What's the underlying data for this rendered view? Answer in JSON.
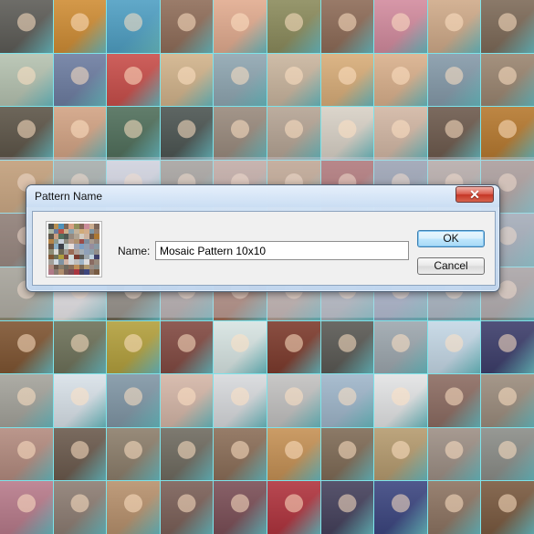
{
  "dialog": {
    "title": "Pattern Name",
    "close_label": "✕",
    "name_label": "Name:",
    "name_value": "Mosaic Pattern 10x10",
    "ok_label": "OK",
    "cancel_label": "Cancel"
  },
  "mosaic": {
    "rows": 10,
    "cols": 10,
    "tile_colors": [
      "#5d5c57",
      "#cf8d35",
      "#4f9fc3",
      "#8f6d59",
      "#e1ab8f",
      "#8b8b5c",
      "#8d6b57",
      "#d28b9e",
      "#cfaa89",
      "#7d6a58",
      "#b5c2b0",
      "#6d7da1",
      "#c84e4a",
      "#d1b38b",
      "#8fa6b1",
      "#c9b59e",
      "#d8ad79",
      "#d9b08c",
      "#859aa9",
      "#9a8570",
      "#5d5548",
      "#d2a384",
      "#506f5b",
      "#4c5552",
      "#998a7d",
      "#b5a494",
      "#d8d1c6",
      "#d2b7a4",
      "#6d5a4d",
      "#b6792f",
      "#b98645",
      "#8f9d92",
      "#cfd6e0",
      "#8f8d80",
      "#b99b8b",
      "#b69470",
      "#9e4d49",
      "#7f8ea0",
      "#a89b90",
      "#96857b",
      "#6b5440",
      "#8fb2c8",
      "#3b3f47",
      "#c7d5d2",
      "#f0e6e2",
      "#a1a8b8",
      "#80a2c7",
      "#96a1b2",
      "#9a8f9f",
      "#8c9ca7",
      "#8e8d76",
      "#e2e2de",
      "#6d6855",
      "#a39b95",
      "#9e6d56",
      "#b3a298",
      "#a8b2b9",
      "#93a4bc",
      "#8ea2ad",
      "#95908b",
      "#7f5532",
      "#6e725a",
      "#b3a03d",
      "#824a42",
      "#d7e4e2",
      "#7d3b2d",
      "#5a5954",
      "#9da7ae",
      "#c4d7e5",
      "#3d3e6b",
      "#a4a39b",
      "#d8e1e8",
      "#8096a5",
      "#d4b6a7",
      "#d7d9dc",
      "#c2c1c0",
      "#9fb6ca",
      "#e2e3e4",
      "#8c6c62",
      "#9b8c7d",
      "#b38b7f",
      "#6b5a4d",
      "#8c7e6b",
      "#6f6b60",
      "#8b6e58",
      "#c59155",
      "#7f6b56",
      "#b59b6f",
      "#9d8f85",
      "#8b8d88",
      "#b87b8b",
      "#8d7d73",
      "#b7916d",
      "#7b6058",
      "#7b4f57",
      "#b0343e",
      "#45415c",
      "#3c4680",
      "#8d7462",
      "#7a5a40"
    ]
  },
  "preview": {
    "cell_colors": [
      "#4f514f",
      "#b88f52",
      "#4f93bc",
      "#7f6757",
      "#d8a184",
      "#92905c",
      "#856657",
      "#cb8d9a",
      "#ccad8f",
      "#7d6759",
      "#aeb7a6",
      "#6b7b9b",
      "#bb5347",
      "#cdb08d",
      "#8aa3ae",
      "#c3b29b",
      "#d0aa79",
      "#d2ad8c",
      "#7f97a5",
      "#987f6c",
      "#5e5649",
      "#cb9f82",
      "#53715f",
      "#4f5853",
      "#978a7e",
      "#b0a392",
      "#d3ccc1",
      "#ccb29f",
      "#6d5a4c",
      "#ad7833",
      "#b48447",
      "#8d9a90",
      "#c9d0da",
      "#8b897d",
      "#b89a89",
      "#af916f",
      "#9b4d48",
      "#7e8d9d",
      "#a89b8f",
      "#93857b",
      "#6b5541",
      "#8aaec4",
      "#3d4049",
      "#c0cecc",
      "#e8dfdc",
      "#9da3b4",
      "#7c9ec2",
      "#939fb0",
      "#968d9d",
      "#8999a4",
      "#8c8c75",
      "#dadad6",
      "#6c6755",
      "#a09893",
      "#9b6c56",
      "#ae9f96",
      "#a5afb6",
      "#8fa0b8",
      "#8b9fab",
      "#928d89",
      "#7d5533",
      "#6d715a",
      "#ad9d40",
      "#804b43",
      "#d0dddb",
      "#7b3c2f",
      "#5b5a55",
      "#9ba5ac",
      "#c0d2df",
      "#40416b",
      "#a29f99",
      "#d2dbe2",
      "#7f93a2",
      "#d0b4a6",
      "#d2d5d8",
      "#bebdbc",
      "#9db3c5",
      "#dcdcdd",
      "#8a6c63",
      "#97897b",
      "#ae887c",
      "#6a594d",
      "#897c6a",
      "#6e6a5f",
      "#896d58",
      "#be8e58",
      "#7c6955",
      "#b0996f",
      "#9a8c83",
      "#898b87",
      "#b07a88",
      "#8a7b72",
      "#b18e6e",
      "#796058",
      "#784f57",
      "#aa3640",
      "#46425c",
      "#3e477e",
      "#8b7362",
      "#785b42"
    ]
  }
}
